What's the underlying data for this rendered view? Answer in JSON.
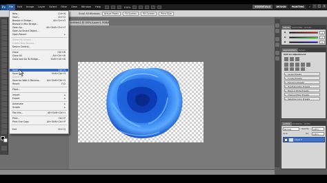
{
  "app": {
    "logo": "Ps",
    "menus": [
      "File",
      "Edit",
      "Image",
      "Layer",
      "Select",
      "Filter",
      "View",
      "Window",
      "Help"
    ],
    "active_menu": "File",
    "zoom": "100%",
    "workspaces": [
      "ESSENTIALS",
      "DESIGN",
      "PAINTING"
    ],
    "workspaces_more": "»"
  },
  "options_bar": {
    "checkbox_label": "Scroll All Windows",
    "buttons": [
      "Actual Pixels",
      "Fit Screen",
      "Fill Screen",
      "Print Size"
    ]
  },
  "document": {
    "tab_title": "Untitled-1 @ 100% (Layer 0, RGB/8) *"
  },
  "file_menu": {
    "items": [
      {
        "label": "New...",
        "shortcut": "Ctrl+N",
        "state": "normal"
      },
      {
        "label": "Open...",
        "shortcut": "Ctrl+O",
        "state": "normal"
      },
      {
        "label": "Browse in Bridge...",
        "shortcut": "Alt+Ctrl+O",
        "state": "normal"
      },
      {
        "label": "Browse in Mini Bridge...",
        "shortcut": "",
        "state": "normal"
      },
      {
        "label": "Open As...",
        "shortcut": "Alt+Shift+Ctrl+O",
        "state": "normal"
      },
      {
        "label": "Open As Smart Object...",
        "shortcut": "",
        "state": "normal"
      },
      {
        "label": "Open Recent",
        "shortcut": "▸",
        "state": "normal"
      },
      {
        "label": "Share My Screen...",
        "shortcut": "",
        "state": "disabled"
      },
      {
        "label": "Create New Review...",
        "shortcut": "",
        "state": "disabled"
      },
      {
        "label": "Device Central...",
        "shortcut": "",
        "state": "normal"
      },
      {
        "label": "Close",
        "shortcut": "Ctrl+W",
        "state": "normal"
      },
      {
        "label": "Close All",
        "shortcut": "Alt+Ctrl+W",
        "state": "normal"
      },
      {
        "label": "Close and Go To Bridge...",
        "shortcut": "Shift+Ctrl+W",
        "state": "normal"
      },
      {
        "label": "Save",
        "shortcut": "Ctrl+S",
        "state": "selected"
      },
      {
        "label": "Save As...",
        "shortcut": "Shift+Ctrl+S",
        "state": "normal"
      },
      {
        "label": "Check In...",
        "shortcut": "",
        "state": "disabled"
      },
      {
        "label": "Save for Web & Devices...",
        "shortcut": "Alt+Shift+Ctrl+S",
        "state": "normal"
      },
      {
        "label": "Revert",
        "shortcut": "F12",
        "state": "normal"
      },
      {
        "label": "Place...",
        "shortcut": "",
        "state": "normal"
      },
      {
        "label": "Import",
        "shortcut": "▸",
        "state": "normal"
      },
      {
        "label": "Export",
        "shortcut": "▸",
        "state": "normal"
      },
      {
        "label": "Automate",
        "shortcut": "▸",
        "state": "normal"
      },
      {
        "label": "Scripts",
        "shortcut": "▸",
        "state": "normal"
      },
      {
        "label": "File Info...",
        "shortcut": "Alt+Shift+Ctrl+I",
        "state": "normal"
      },
      {
        "label": "Print...",
        "shortcut": "Ctrl+P",
        "state": "normal"
      },
      {
        "label": "Print One Copy",
        "shortcut": "Alt+Shift+Ctrl+P",
        "state": "normal"
      },
      {
        "label": "Exit",
        "shortcut": "Ctrl+Q",
        "state": "normal"
      }
    ]
  },
  "color_panel": {
    "tabs": [
      "COLOR",
      "SWATCHES",
      "STYLES"
    ],
    "channels": [
      {
        "label": "R",
        "value": "0"
      },
      {
        "label": "G",
        "value": "0"
      },
      {
        "label": "B",
        "value": "0"
      }
    ]
  },
  "adjustments_panel": {
    "tabs": [
      "ADJUSTMENTS",
      "MASKS"
    ],
    "heading": "Add an adjustment",
    "presets": [
      "Levels Presets",
      "Curves Presets",
      "Exposure Presets",
      "Hue/Saturation Presets",
      "Black & White Presets",
      "Channel Mixer Presets",
      "Selective Color Presets"
    ]
  },
  "layers_panel": {
    "tabs": [
      "LAYERS",
      "CHANNELS",
      "PATHS"
    ],
    "blend_mode": "Normal",
    "opacity_label": "Opacity:",
    "opacity": "100%",
    "lock_label": "Lock:",
    "fill_label": "Fill:",
    "fill": "100%",
    "layer_name": "Layer 0"
  },
  "colors": {
    "menu_highlight": "#3168c6",
    "rose_light": "#5aa9ff",
    "rose_dark": "#0a2fa0",
    "layer_selected": "#3f72c8"
  }
}
